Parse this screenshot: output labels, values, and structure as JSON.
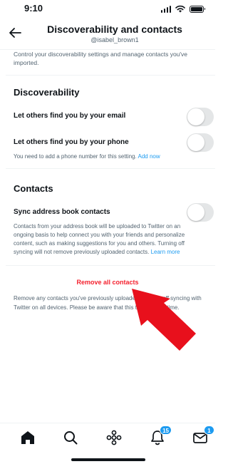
{
  "status_bar": {
    "time": "9:10"
  },
  "header": {
    "title": "Discoverability and contacts",
    "handle": "@isabel_brown1"
  },
  "intro_text": "Control your discoverability settings and manage contacts you've imported.",
  "discoverability": {
    "title": "Discoverability",
    "email_label": "Let others find you by your email",
    "email_enabled": false,
    "phone_label": "Let others find you by your phone",
    "phone_enabled": false,
    "phone_note": "You need to add a phone number for this setting.",
    "phone_note_link": "Add now"
  },
  "contacts": {
    "title": "Contacts",
    "sync_label": "Sync address book contacts",
    "sync_enabled": false,
    "sync_note": "Contacts from your address book will be uploaded to Twitter on an ongoing basis to help connect you with your friends and personalize content, such as making suggestions for you and others. Turning off syncing will not remove previously uploaded contacts.",
    "sync_note_link": "Learn more"
  },
  "remove": {
    "label": "Remove all contacts",
    "note": "Remove any contacts you've previously uploaded and turn off syncing with Twitter on all devices. Please be aware that this takes a little time."
  },
  "tabbar": {
    "notifications_badge": "15",
    "messages_badge": "1"
  },
  "colors": {
    "accent": "#1d9bf0",
    "danger": "#f4212e",
    "annotation_arrow": "#e8101c",
    "toggle_off": "#e4e6e7"
  },
  "icons": [
    "back-arrow-icon",
    "home-icon",
    "search-icon",
    "spaces-icon",
    "bell-icon",
    "mail-icon"
  ]
}
